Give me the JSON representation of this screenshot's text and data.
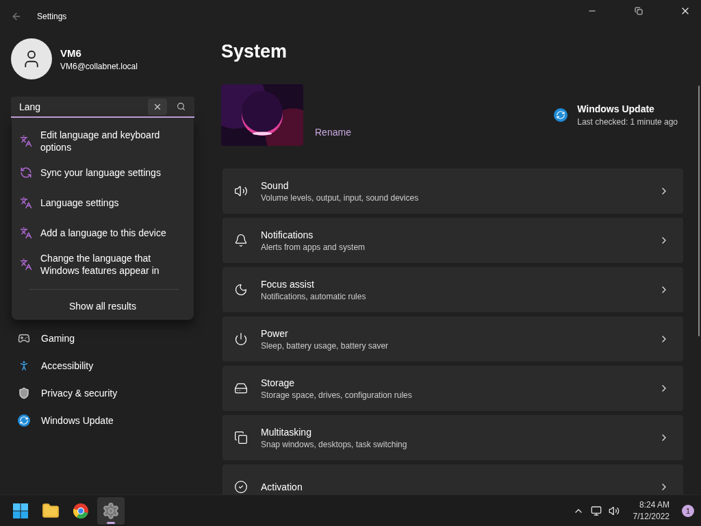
{
  "window": {
    "title": "Settings"
  },
  "account": {
    "name": "VM6",
    "email": "VM6@collabnet.local"
  },
  "search": {
    "value": "Lang",
    "results": [
      {
        "kind": "language",
        "label": "Edit language and keyboard options"
      },
      {
        "kind": "sync",
        "label": "Sync your language settings"
      },
      {
        "kind": "language",
        "label": "Language settings"
      },
      {
        "kind": "language",
        "label": "Add a language to this device"
      },
      {
        "kind": "language",
        "label": "Change the language that Windows features appear in"
      }
    ],
    "show_all": "Show all results"
  },
  "sidebar": {
    "items": [
      {
        "kind": "gaming",
        "label": "Gaming"
      },
      {
        "kind": "accessibility",
        "label": "Accessibility"
      },
      {
        "kind": "privacy",
        "label": "Privacy & security"
      },
      {
        "kind": "update",
        "label": "Windows Update"
      }
    ]
  },
  "page": {
    "title": "System",
    "rename": "Rename",
    "update": {
      "title": "Windows Update",
      "status": "Last checked: 1 minute ago"
    },
    "cards": [
      {
        "kind": "sound",
        "title": "Sound",
        "subtitle": "Volume levels, output, input, sound devices"
      },
      {
        "kind": "notifications",
        "title": "Notifications",
        "subtitle": "Alerts from apps and system"
      },
      {
        "kind": "focus",
        "title": "Focus assist",
        "subtitle": "Notifications, automatic rules"
      },
      {
        "kind": "power",
        "title": "Power",
        "subtitle": "Sleep, battery usage, battery saver"
      },
      {
        "kind": "storage",
        "title": "Storage",
        "subtitle": "Storage space, drives, configuration rules"
      },
      {
        "kind": "multitasking",
        "title": "Multitasking",
        "subtitle": "Snap windows, desktops, task switching"
      },
      {
        "kind": "activation",
        "title": "Activation"
      }
    ]
  },
  "taskbar": {
    "apps": [
      {
        "kind": "start",
        "selected": false
      },
      {
        "kind": "files",
        "selected": false
      },
      {
        "kind": "browser",
        "selected": false
      },
      {
        "kind": "settings",
        "selected": true
      }
    ],
    "time": "8:24 AM",
    "date": "7/12/2022",
    "badge": "1"
  }
}
